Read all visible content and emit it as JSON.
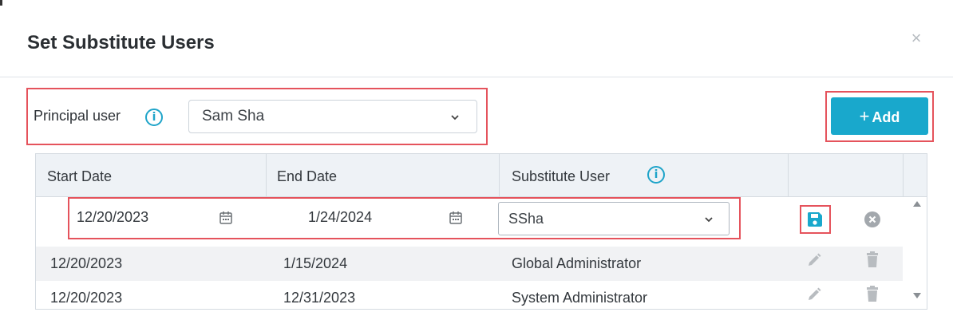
{
  "dialog": {
    "title": "Set Substitute Users",
    "close_icon": "close-icon"
  },
  "principal": {
    "label": "Principal user",
    "info_icon": "info-icon",
    "selected": "Sam Sha"
  },
  "toolbar": {
    "add_label": "Add",
    "add_icon": "plus-icon"
  },
  "table": {
    "columns": [
      "Start Date",
      "End Date",
      "Substitute User"
    ],
    "edit_row": {
      "start_date": "12/20/2023",
      "end_date": "1/24/2024",
      "substitute": "SSha"
    },
    "rows": [
      {
        "start_date": "12/20/2023",
        "end_date": "1/15/2024",
        "substitute": "Global Administrator"
      },
      {
        "start_date": "12/20/2023",
        "end_date": "12/31/2023",
        "substitute": "System Administrator"
      }
    ]
  },
  "colors": {
    "accent": "#19a8cc",
    "highlight": "#e5535c",
    "header_bg": "#eef2f6"
  }
}
